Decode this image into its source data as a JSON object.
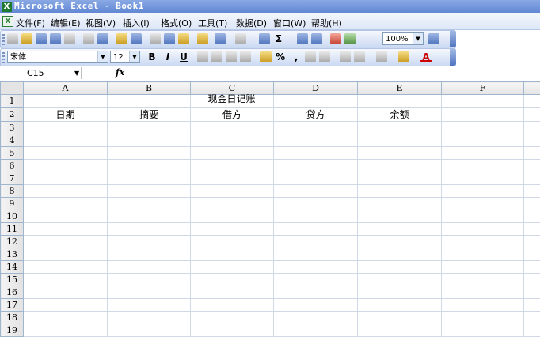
{
  "window": {
    "title": "Microsoft Excel - Book1",
    "app_icon": "X"
  },
  "menu": {
    "items": [
      "文件(F)",
      "编辑(E)",
      "视图(V)",
      "插入(I)",
      "格式(O)",
      "工具(T)",
      "数据(D)",
      "窗口(W)",
      "帮助(H)"
    ]
  },
  "toolbar_standard": {
    "zoom": "100%"
  },
  "toolbar_format": {
    "font_name": "宋体",
    "font_size": "12",
    "bold": "B",
    "italic": "I",
    "underline": "U",
    "percent": "%",
    "comma": ",",
    "font_color_glyph": "A"
  },
  "formula_bar": {
    "name_box": "C15",
    "fx": "fx",
    "content": ""
  },
  "sheet": {
    "columns": [
      "A",
      "B",
      "C",
      "D",
      "E",
      "F"
    ],
    "rows": [
      "1",
      "2",
      "3",
      "4",
      "5",
      "6",
      "7",
      "8",
      "9",
      "10",
      "11",
      "12",
      "13",
      "14",
      "15",
      "16",
      "17",
      "18",
      "19"
    ],
    "title": "现金日记账",
    "headers": [
      "日期",
      "摘要",
      "借方",
      "贷方",
      "余额"
    ]
  }
}
